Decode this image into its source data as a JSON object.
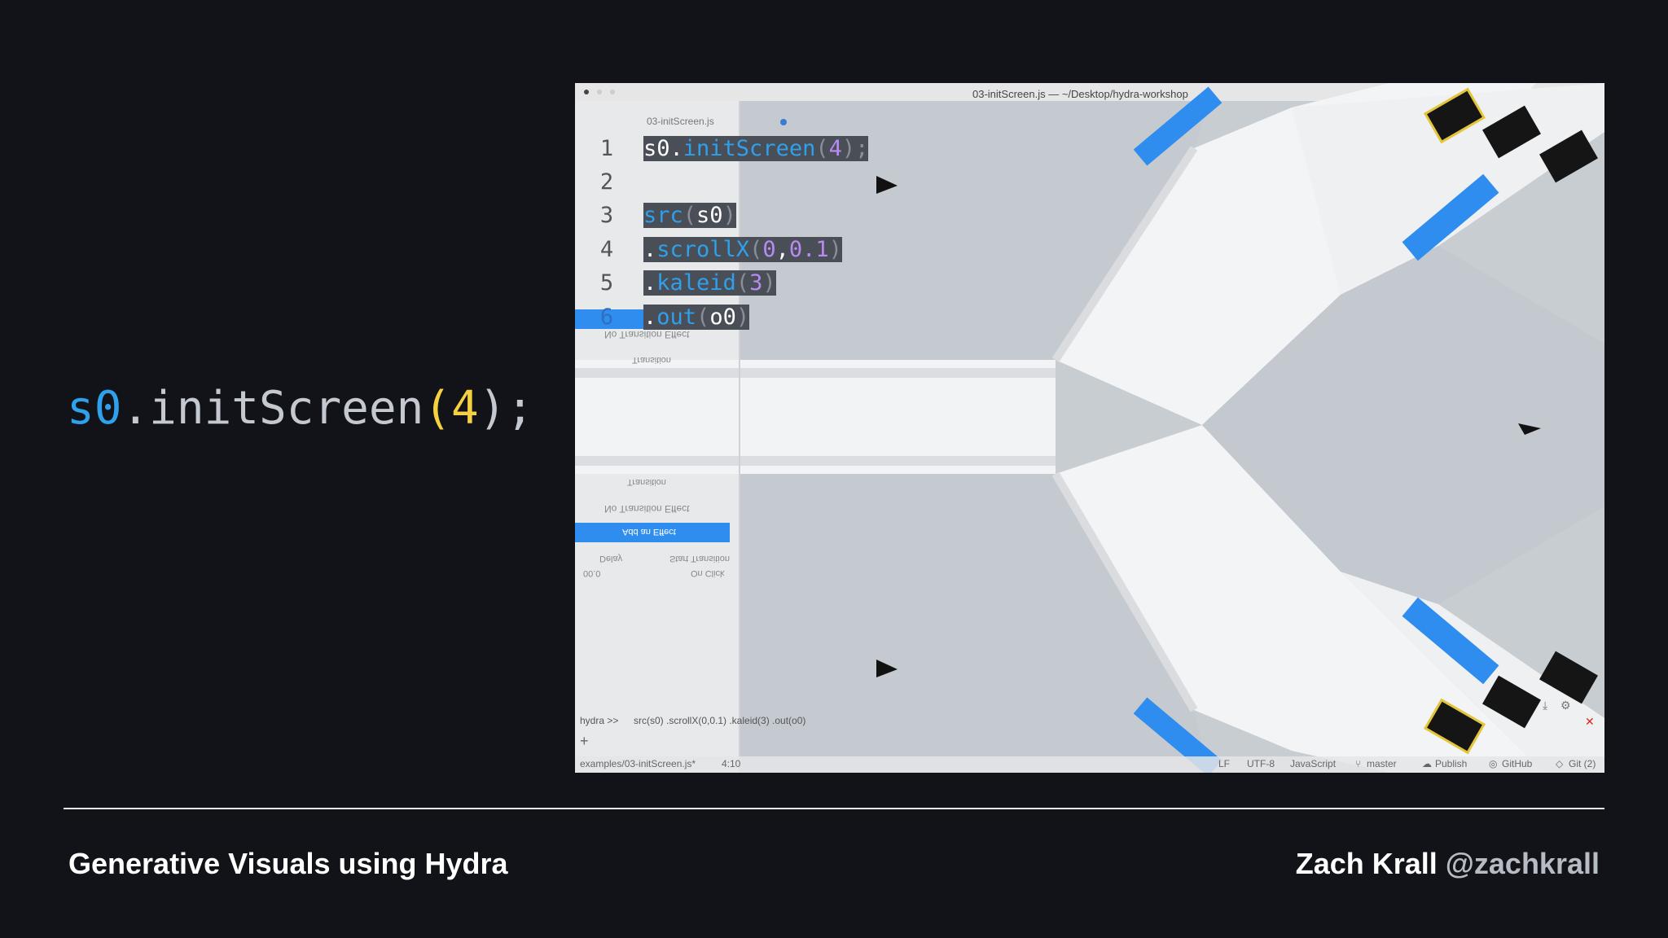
{
  "slide": {
    "big_code": {
      "prefix": "s0",
      "dot": ".",
      "fn": "initScreen",
      "open": "(",
      "arg": "4",
      "close": ");"
    },
    "footer": {
      "title": "Generative Visuals using Hydra",
      "author": "Zach Krall",
      "handle": "@zachkrall"
    }
  },
  "editor": {
    "window_title": "03-initScreen.js — ~/Desktop/hydra-workshop",
    "tab_title": "03-initScreen.js",
    "lines": [
      {
        "num": "1",
        "parts": [
          "s0",
          ".",
          "initScreen",
          "(",
          "4",
          ");"
        ]
      },
      {
        "num": "2",
        "parts": []
      },
      {
        "num": "3",
        "parts": [
          "src",
          "(",
          "s0",
          ")"
        ]
      },
      {
        "num": "4",
        "parts": [
          ".",
          "scrollX",
          "(",
          "0",
          ",",
          "0.1",
          ")"
        ]
      },
      {
        "num": "5",
        "parts": [
          ".",
          "kaleid",
          "(",
          "3",
          ")"
        ]
      },
      {
        "num": "6",
        "parts": [
          ".",
          "out",
          "(",
          "o0",
          ")"
        ]
      }
    ],
    "console": {
      "prompt": "hydra >>",
      "command": "src(s0) .scrollX(0,0.1) .kaleid(3) .out(o0)"
    },
    "status_bar": {
      "file": "examples/03-initScreen.js*",
      "cursor": "4:10",
      "line_ending": "LF",
      "encoding": "UTF-8",
      "grammar": "JavaScript",
      "branch": "master",
      "publish": "Publish",
      "github": "GitHub",
      "git": "Git (2)"
    }
  },
  "mirrored_panel": {
    "transition_header": "Transition",
    "no_effect": "No Transition Effect",
    "add_effect": "Add an Effect",
    "start_transition": "Start Transition",
    "on_click": "On Click",
    "delay": "Delay",
    "delay_value": "00.0"
  },
  "colors": {
    "background": "#111318",
    "code_blue": "#2ea0ec",
    "code_yellow": "#f5d142",
    "editor_purple": "#b98bf2",
    "button_blue": "#2f8df0"
  },
  "icons": [
    "add-icon",
    "branch-icon",
    "publish-icon",
    "github-icon",
    "git-icon",
    "close-icon",
    "gear-icon",
    "download-icon",
    "cursor-icon"
  ]
}
